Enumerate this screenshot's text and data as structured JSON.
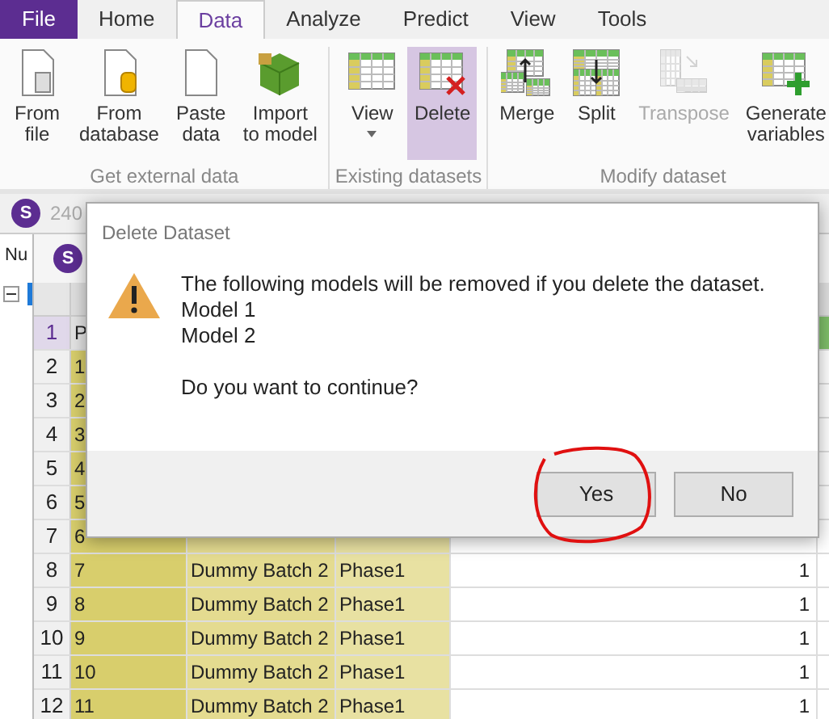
{
  "file_menu": {
    "label": "File"
  },
  "tabs": [
    {
      "label": "Home",
      "selected": false
    },
    {
      "label": "Data",
      "selected": true
    },
    {
      "label": "Analyze",
      "selected": false
    },
    {
      "label": "Predict",
      "selected": false
    },
    {
      "label": "View",
      "selected": false
    },
    {
      "label": "Tools",
      "selected": false
    }
  ],
  "ribbon_groups": [
    {
      "label": "Get external data",
      "buttons": [
        {
          "label": "From\nfile",
          "highlighted": false,
          "disabled": false,
          "dropdown": false
        },
        {
          "label": "From\ndatabase",
          "highlighted": false,
          "disabled": false,
          "dropdown": false
        },
        {
          "label": "Paste\ndata",
          "highlighted": false,
          "disabled": false,
          "dropdown": false
        },
        {
          "label": "Import\nto model",
          "highlighted": false,
          "disabled": false,
          "dropdown": false
        }
      ]
    },
    {
      "label": "Existing datasets",
      "buttons": [
        {
          "label": "View",
          "highlighted": false,
          "disabled": false,
          "dropdown": true
        },
        {
          "label": "Delete",
          "highlighted": true,
          "disabled": false,
          "dropdown": false
        }
      ]
    },
    {
      "label": "Modify dataset",
      "buttons": [
        {
          "label": "Merge",
          "highlighted": false,
          "disabled": false,
          "dropdown": false
        },
        {
          "label": "Split",
          "highlighted": false,
          "disabled": false,
          "dropdown": false
        },
        {
          "label": "Transpose",
          "highlighted": false,
          "disabled": true,
          "dropdown": false
        },
        {
          "label": "Generate\nvariables",
          "highlighted": false,
          "disabled": false,
          "dropdown": false
        }
      ]
    }
  ],
  "toolbar": {
    "badge": "S",
    "text": "240"
  },
  "left_pane": {
    "header": "Nu"
  },
  "dataset_window": {
    "badge": "S"
  },
  "grid": {
    "rows": [
      {
        "number": "1",
        "kind": "header",
        "cells": [
          "P"
        ]
      },
      {
        "number": "2",
        "kind": "data",
        "cells": [
          "1"
        ]
      },
      {
        "number": "3",
        "kind": "data",
        "cells": [
          "2"
        ]
      },
      {
        "number": "4",
        "kind": "data",
        "cells": [
          "3"
        ]
      },
      {
        "number": "5",
        "kind": "data",
        "cells": [
          "4"
        ]
      },
      {
        "number": "6",
        "kind": "data",
        "cells": [
          "5"
        ]
      },
      {
        "number": "7",
        "kind": "data",
        "cells": [
          "6"
        ]
      },
      {
        "number": "8",
        "kind": "data",
        "cells": [
          "7",
          "Dummy Batch 2",
          "Phase1",
          "1"
        ]
      },
      {
        "number": "9",
        "kind": "data",
        "cells": [
          "8",
          "Dummy Batch 2",
          "Phase1",
          "1"
        ]
      },
      {
        "number": "10",
        "kind": "data",
        "cells": [
          "9",
          "Dummy Batch 2",
          "Phase1",
          "1"
        ]
      },
      {
        "number": "11",
        "kind": "data",
        "cells": [
          "10",
          "Dummy Batch 2",
          "Phase1",
          "1"
        ]
      },
      {
        "number": "12",
        "kind": "data",
        "cells": [
          "11",
          "Dummy Batch 2",
          "Phase1",
          "1"
        ]
      }
    ]
  },
  "dialog": {
    "title": "Delete Dataset",
    "message": "The following models will be removed if you delete the dataset.",
    "models": [
      "Model 1",
      "Model 2"
    ],
    "question": "Do you want to continue?",
    "buttons": [
      "Yes",
      "No"
    ]
  }
}
